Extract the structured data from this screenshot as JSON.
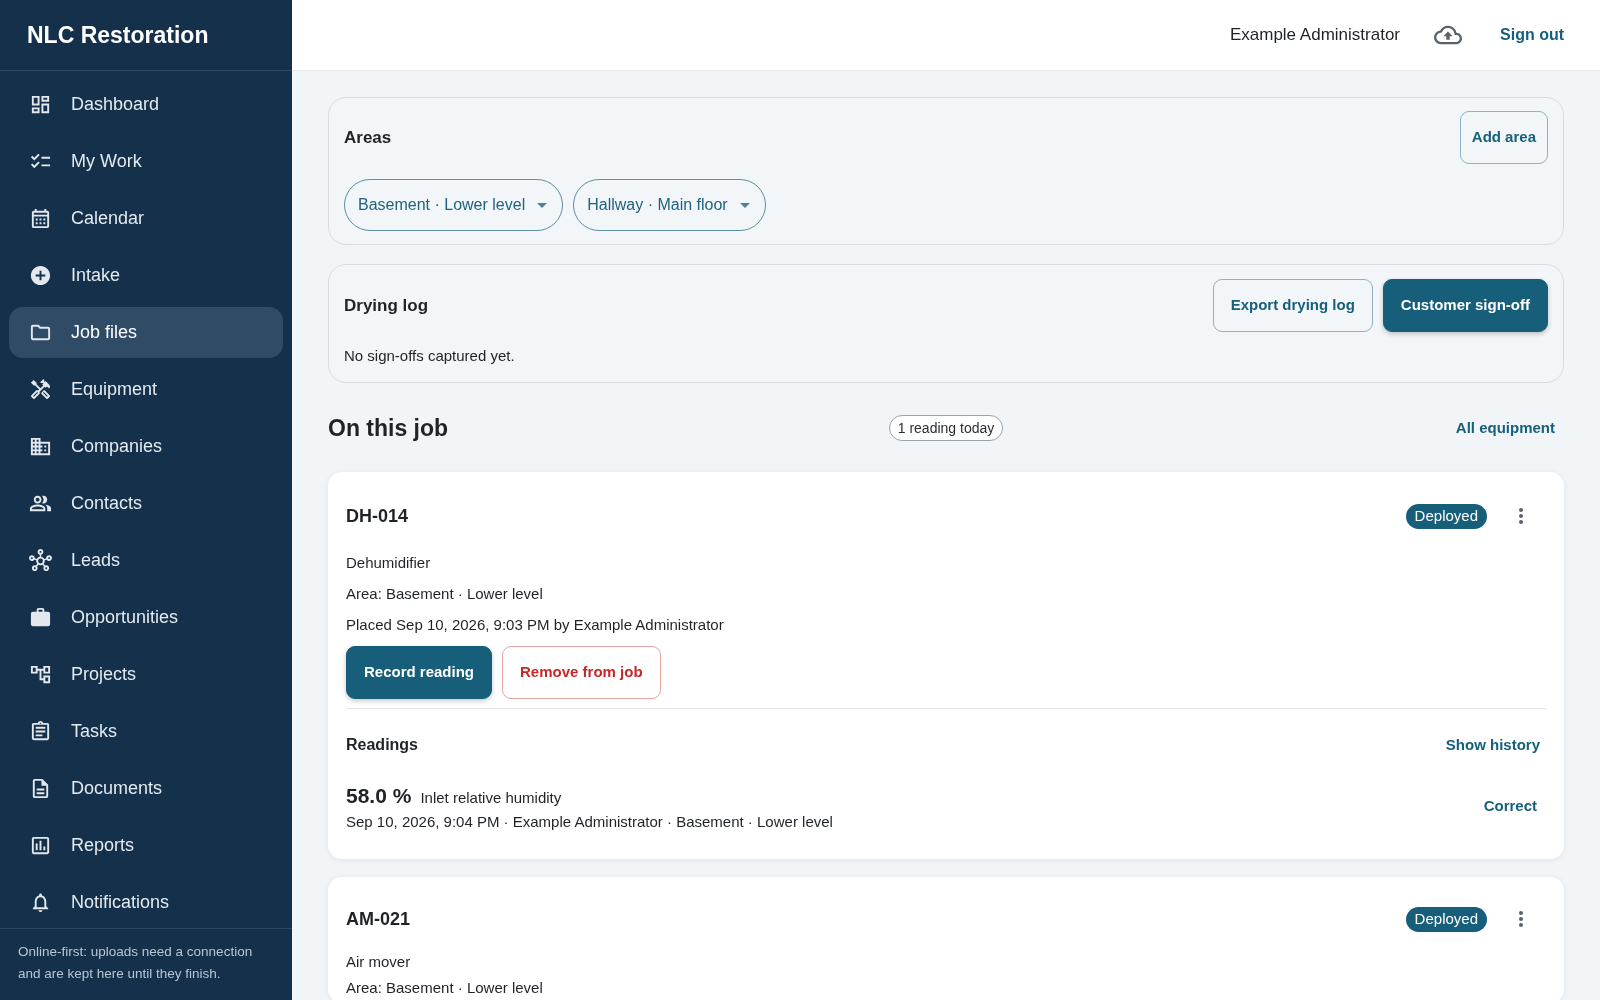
{
  "sidebar": {
    "title": "NLC Restoration",
    "items": [
      {
        "label": "Dashboard",
        "selected": false
      },
      {
        "label": "My Work",
        "selected": false
      },
      {
        "label": "Calendar",
        "selected": false
      },
      {
        "label": "Intake",
        "selected": false
      },
      {
        "label": "Job files",
        "selected": true
      },
      {
        "label": "Equipment",
        "selected": false
      },
      {
        "label": "Companies",
        "selected": false
      },
      {
        "label": "Contacts",
        "selected": false
      },
      {
        "label": "Leads",
        "selected": false
      },
      {
        "label": "Opportunities",
        "selected": false
      },
      {
        "label": "Projects",
        "selected": false
      },
      {
        "label": "Tasks",
        "selected": false
      },
      {
        "label": "Documents",
        "selected": false
      },
      {
        "label": "Reports",
        "selected": false
      },
      {
        "label": "Notifications",
        "selected": false
      }
    ],
    "footer_note": "Online-first: uploads need a connection and are kept here until they finish."
  },
  "header": {
    "user": "Example Administrator",
    "sign_out": "Sign out"
  },
  "areas": {
    "title": "Areas",
    "add_button": "Add area",
    "chips": [
      {
        "label": "Basement · Lower level"
      },
      {
        "label": "Hallway · Main floor"
      }
    ]
  },
  "drying_log": {
    "title": "Drying log",
    "buttons": [
      {
        "label": "Export drying log",
        "kind": "outline"
      },
      {
        "label": "Customer sign-off",
        "kind": "primary"
      }
    ],
    "note": "No sign-offs captured yet."
  },
  "equipment_section": {
    "title": "On this job",
    "badge": "1 reading today",
    "link": "All equipment"
  },
  "equipment": [
    {
      "code": "DH-014",
      "status": "Deployed",
      "type": "Dehumidifier",
      "area": "Area: Basement · Lower level",
      "placed": "Placed Sep 10, 2026, 9:03 PM by Example Administrator",
      "actions": [
        {
          "label": "Record reading",
          "kind": "primary"
        },
        {
          "label": "Remove from job",
          "kind": "danger"
        }
      ],
      "readings": {
        "title": "Readings",
        "link": "Show history",
        "items": [
          {
            "value": "58.0 %",
            "label": "Inlet relative humidity",
            "meta": "Sep 10, 2026, 9:04 PM · Example Administrator · Basement · Lower level",
            "action": "Correct"
          }
        ]
      }
    },
    {
      "code": "AM-021",
      "status": "Deployed",
      "type": "Air mover",
      "area": "Area: Basement · Lower level"
    }
  ]
}
